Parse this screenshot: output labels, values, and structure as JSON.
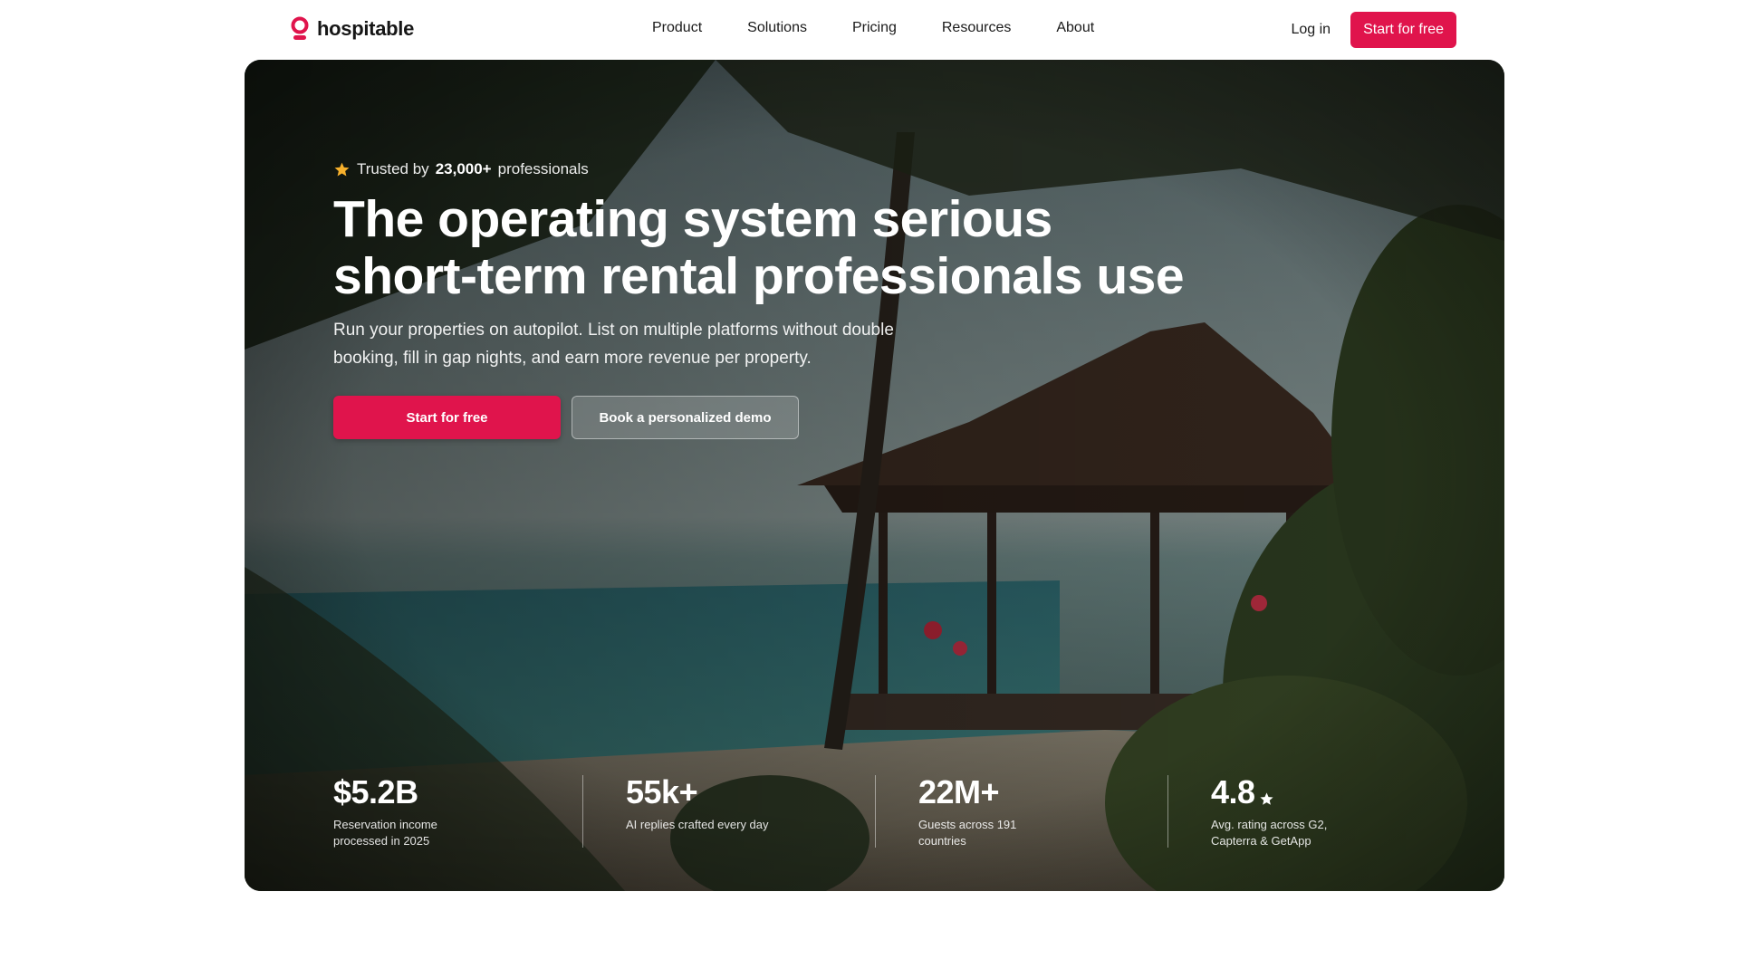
{
  "brand": {
    "name": "hospitable",
    "accent": "#e0144c"
  },
  "nav": {
    "links": [
      "Product",
      "Solutions",
      "Pricing",
      "Resources",
      "About"
    ],
    "login": "Log in",
    "cta": "Start for free"
  },
  "hero": {
    "trusted_prefix": "Trusted by",
    "trusted_count": "23,000+",
    "trusted_suffix": "professionals",
    "headline_line1": "The operating system serious",
    "headline_line2": "short-term rental professionals use",
    "subheadline": "Run your properties on autopilot. List on multiple platforms without double booking, fill in gap nights, and earn more revenue per property.",
    "primary_cta": "Start for free",
    "secondary_cta": "Book a personalized demo",
    "background": "tropical beach villa with palm trees (photo)"
  },
  "stats": [
    {
      "value": "$5.2B",
      "label": "Reservation income processed in 2025"
    },
    {
      "value": "55k+",
      "label": "AI replies crafted every day"
    },
    {
      "value": "22M+",
      "label": "Guests across 191 countries"
    },
    {
      "value": "4.8",
      "label": "Avg. rating across G2, Capterra & GetApp",
      "icon": "star-icon"
    }
  ]
}
